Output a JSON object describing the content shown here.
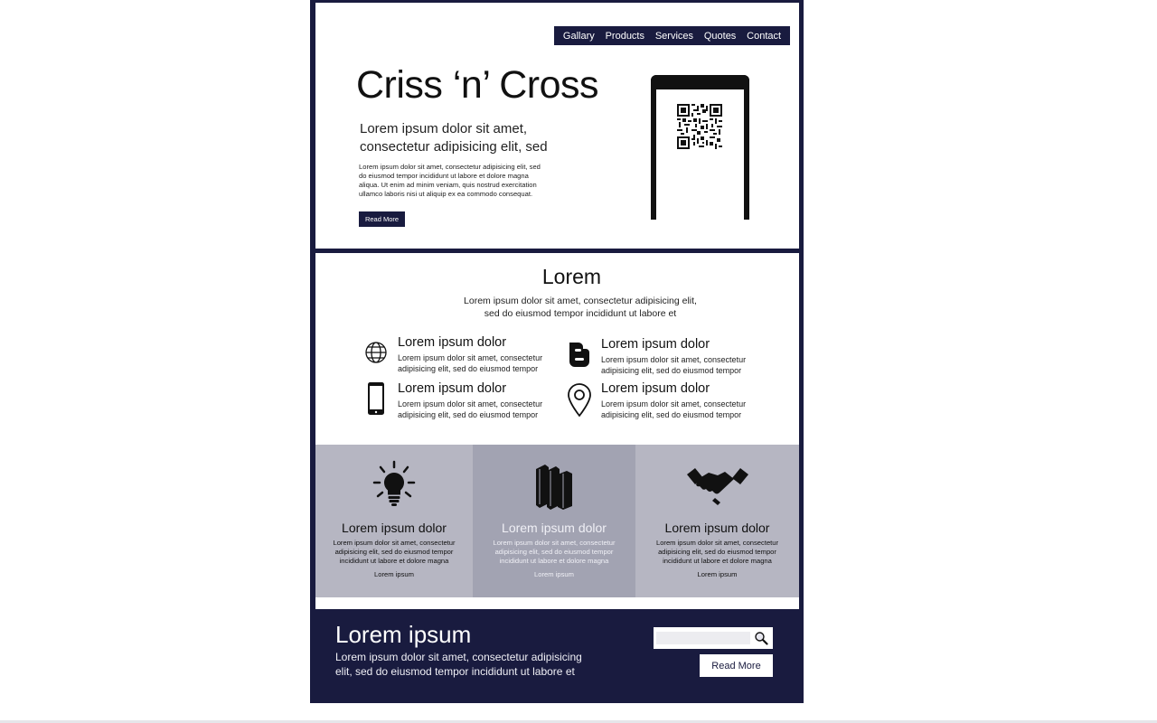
{
  "nav": {
    "items": [
      "Gallary",
      "Products",
      "Services",
      "Quotes",
      "Contact"
    ]
  },
  "hero": {
    "title": "Criss ‘n’ Cross",
    "subtitle": "Lorem ipsum dolor sit amet, consectetur adipisicing elit, sed",
    "body": "Lorem ipsum dolor sit amet, consectetur adipisicing elit, sed do eiusmod tempor incididunt ut labore et dolore magna aliqua. Ut enim ad minim veniam, quis nostrud exercitation ullamco laboris nisi ut aliquip ex ea commodo consequat.",
    "button_label": "Read More",
    "phone_icon": "qr-code-icon"
  },
  "features": {
    "title": "Lorem",
    "description": "Lorem ipsum dolor sit amet, consectetur adipisicing elit, sed do eiusmod tempor incididunt ut labore et",
    "items": [
      {
        "icon": "globe-icon",
        "title": "Lorem ipsum dolor",
        "text": "Lorem ipsum dolor sit amet, consectetur adipisicing elit, sed do eiusmod tempor"
      },
      {
        "icon": "blogger-icon",
        "title": "Lorem ipsum dolor",
        "text": "Lorem ipsum dolor sit amet, consectetur adipisicing elit, sed do eiusmod tempor"
      },
      {
        "icon": "mobile-phone-icon",
        "title": "Lorem ipsum dolor",
        "text": "Lorem ipsum dolor sit amet, consectetur adipisicing elit, sed do eiusmod tempor"
      },
      {
        "icon": "location-pin-icon",
        "title": "Lorem ipsum dolor",
        "text": "Lorem ipsum dolor sit amet, consectetur adipisicing elit, sed do eiusmod tempor"
      }
    ]
  },
  "cards": [
    {
      "icon": "lightbulb-icon",
      "title": "Lorem ipsum dolor",
      "text": "Lorem ipsum dolor sit amet, consectetur adipisicing elit, sed do eiusmod tempor incididunt ut labore et dolore magna",
      "link": "Lorem ipsum"
    },
    {
      "icon": "books-icon",
      "title": "Lorem ipsum dolor",
      "text": "Lorem ipsum dolor sit amet, consectetur adipisicing elit, sed do eiusmod tempor incididunt ut labore et dolore magna",
      "link": "Lorem ipsum"
    },
    {
      "icon": "handshake-icon",
      "title": "Lorem ipsum dolor",
      "text": "Lorem ipsum dolor sit amet, consectetur adipisicing elit, sed do eiusmod tempor incididunt ut labore et dolore magna",
      "link": "Lorem ipsum"
    }
  ],
  "footer": {
    "title": "Lorem ipsum",
    "text": "Lorem ipsum dolor sit amet, consectetur adipisicing elit, sed do eiusmod tempor incididunt ut labore et",
    "search_placeholder": "",
    "button_label": "Read More"
  },
  "colors": {
    "navy": "#191b3f",
    "card_light": "#b6b6c2",
    "card_mid": "#a2a3b2",
    "white": "#ffffff"
  }
}
